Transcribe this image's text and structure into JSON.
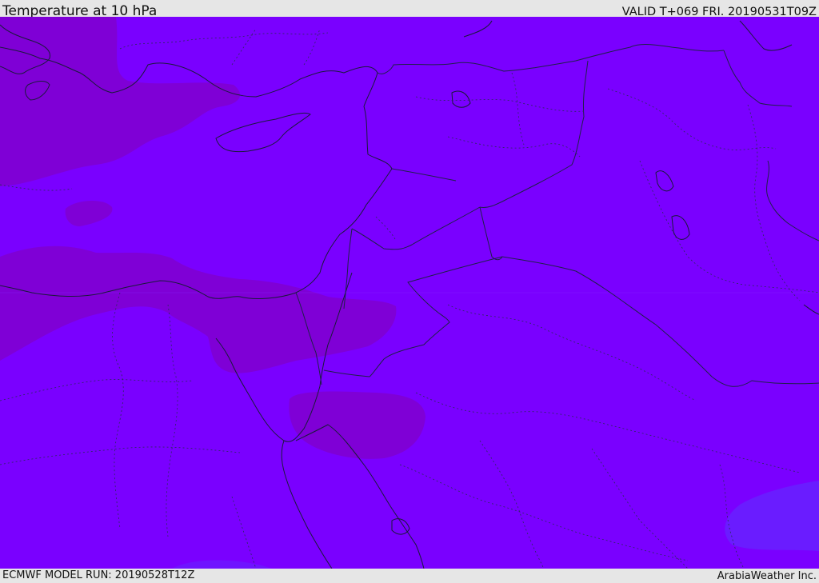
{
  "header": {
    "title": "Temperature at 10 hPa",
    "valid_time": "VALID T+069 FRI. 20190531T09Z"
  },
  "footer": {
    "model_run": "ECMWF MODEL RUN: 20190528T12Z",
    "credit": "ArabiaWeather Inc."
  },
  "map": {
    "region": "Eastern Mediterranean and Middle East",
    "field": "temperature",
    "colors": {
      "base_field": "#7a00ff",
      "warmer_patch": "#7e00d9",
      "cooler_patch": "#6a1cff",
      "coastline": "#1a1a3a",
      "border": "#20204a",
      "subnational_border": "#2a2a5a"
    }
  }
}
